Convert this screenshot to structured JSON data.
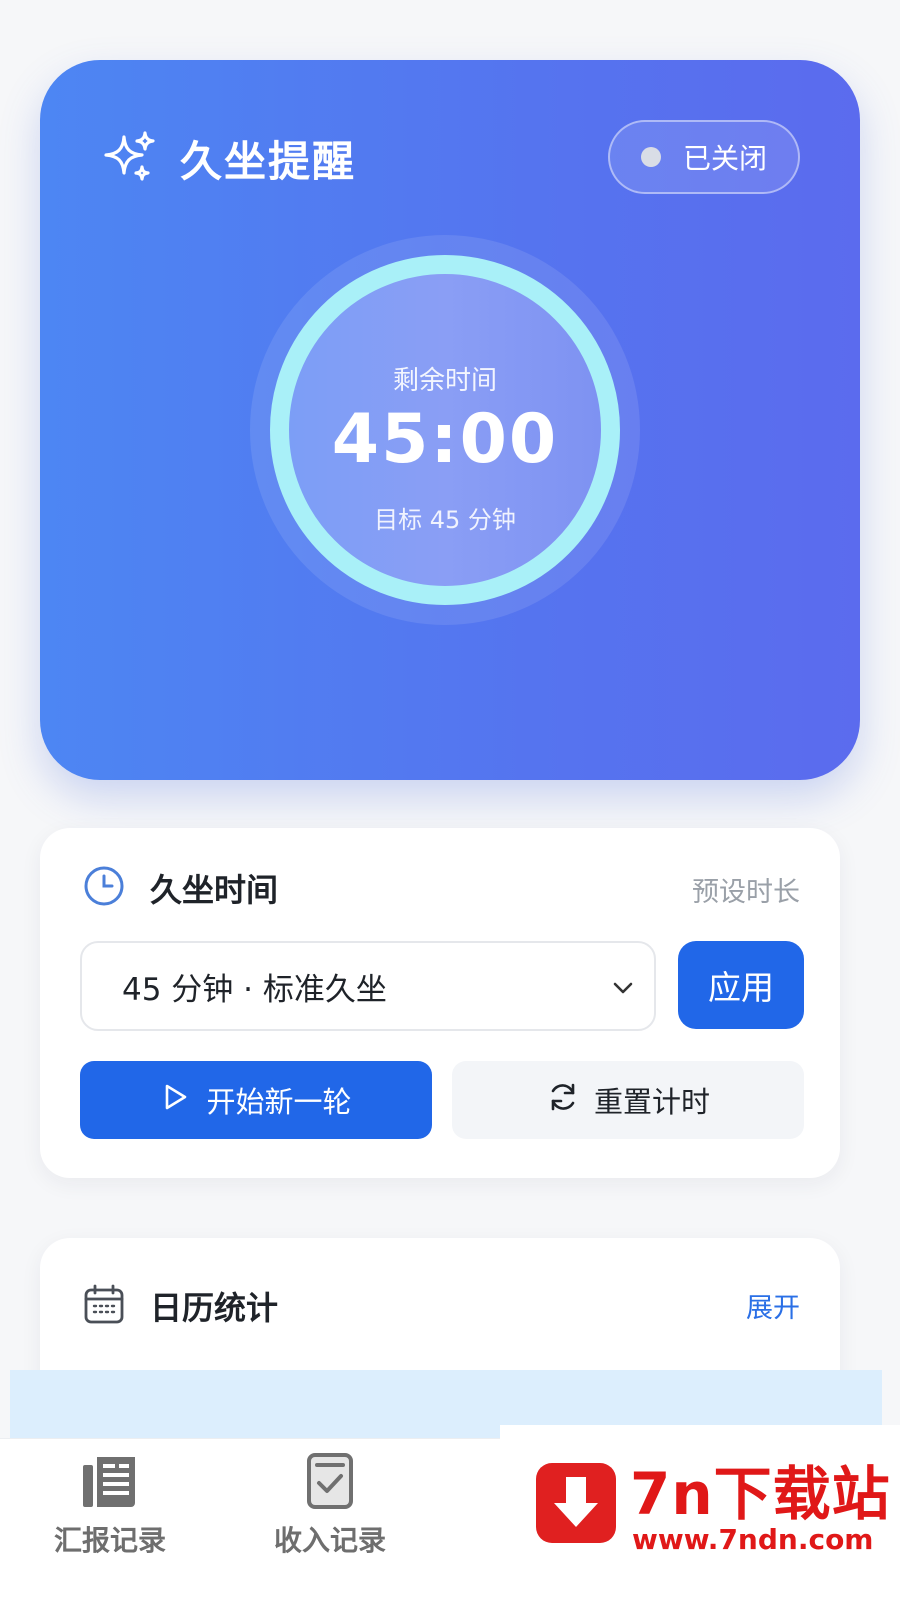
{
  "hero": {
    "title": "久坐提醒",
    "status": "已关闭",
    "ring_label": "剩余时间",
    "time_remaining": "45:00",
    "target": "目标 45 分钟"
  },
  "sit_time": {
    "title": "久坐时间",
    "preset_label": "预设时长",
    "selected_option": "45 分钟 · 标准久坐",
    "apply_label": "应用",
    "start_label": "开始新一轮",
    "reset_label": "重置计时"
  },
  "calendar": {
    "title": "日历统计",
    "toggle_label": "展开"
  },
  "tabbar": {
    "items": [
      {
        "label": "汇报记录",
        "icon": "newspaper-icon"
      },
      {
        "label": "收入记录",
        "icon": "checklist-icon"
      }
    ]
  },
  "watermark": {
    "name": "7n下载站",
    "url": "www.7ndn.com"
  },
  "colors": {
    "hero_gradient_start": "#4d86f3",
    "hero_gradient_end": "#5b6bee",
    "primary": "#2167e8",
    "ring": "#a9f0f8",
    "link": "#2a6fe6",
    "watermark_red": "#e01818"
  }
}
